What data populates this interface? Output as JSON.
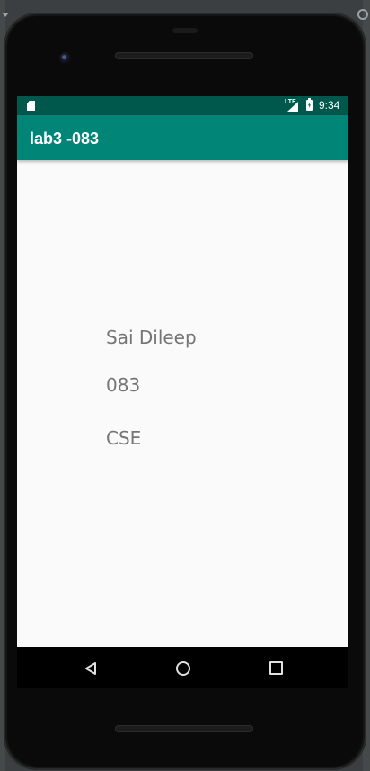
{
  "status_bar": {
    "network_label": "LTE",
    "time": "9:34",
    "icons": [
      "sd-card-icon",
      "signal-icon",
      "battery-charging-icon"
    ]
  },
  "app_bar": {
    "title": "lab3 -083"
  },
  "content": {
    "name": "Sai Dileep",
    "roll_no": "083",
    "branch": "CSE"
  },
  "nav_bar": {
    "icons": [
      "back-icon",
      "home-icon",
      "recents-icon"
    ]
  },
  "colors": {
    "status_bar": "#00574b",
    "app_bar": "#008577",
    "screen_bg": "#fafafa",
    "content_text": "#757575",
    "nav_bar": "#000000"
  }
}
